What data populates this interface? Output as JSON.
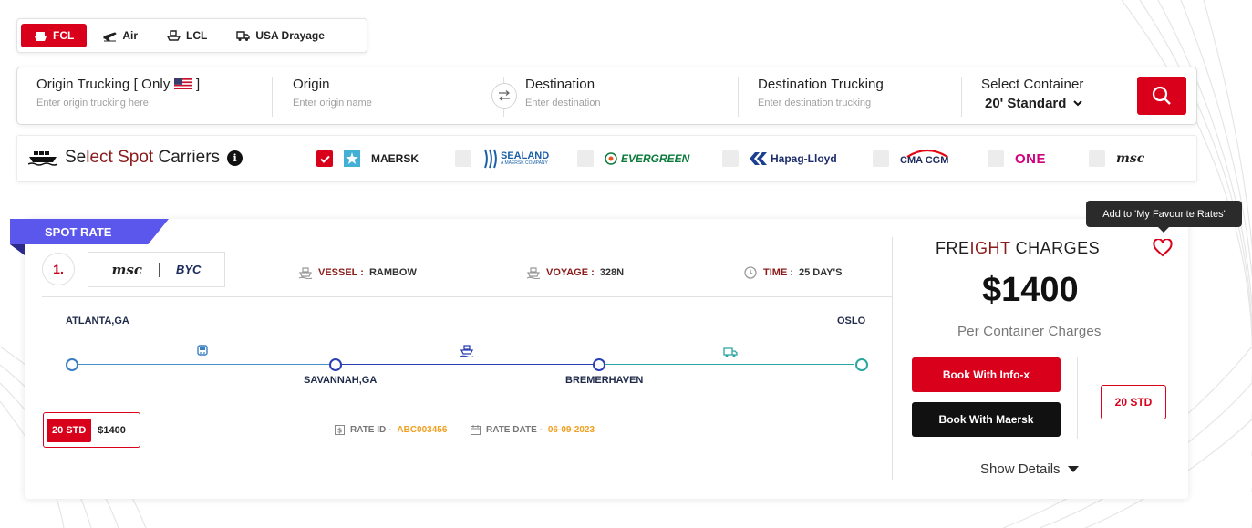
{
  "colors": {
    "accent": "#d9001b",
    "ribbon": "#5b57ec",
    "dark_accent": "#8b1a1a",
    "amber": "#f0a020"
  },
  "mode_tabs": [
    {
      "label": "FCL",
      "icon": "ship-icon",
      "active": true
    },
    {
      "label": "Air",
      "icon": "plane-icon"
    },
    {
      "label": "LCL",
      "icon": "boat-icon"
    },
    {
      "label": "USA Drayage",
      "icon": "truck-icon"
    }
  ],
  "search": {
    "origin_trucking": {
      "label_pre": "Origin Trucking [ Only",
      "label_post": "]",
      "placeholder": "Enter origin trucking here"
    },
    "origin": {
      "label": "Origin",
      "placeholder": "Enter origin name"
    },
    "destination": {
      "label": "Destination",
      "placeholder": "Enter destination"
    },
    "destination_trucking": {
      "label": "Destination Trucking",
      "placeholder": "Enter destination trucking"
    },
    "container": {
      "label": "Select Container",
      "value": "20' Standard"
    }
  },
  "carriers": {
    "title_pre": "Se",
    "title_acc": "lect Spot",
    "title_post": " Carriers",
    "items": [
      {
        "name": "MAERSK",
        "checked": true
      },
      {
        "name": "SEALAND",
        "sub": "A MAERSK COMPANY",
        "checked": false
      },
      {
        "name": "EVERGREEN",
        "checked": false
      },
      {
        "name": "Hapag-Lloyd",
        "checked": false
      },
      {
        "name": "CMA CGM",
        "checked": false
      },
      {
        "name": "ONE",
        "checked": false
      },
      {
        "name": "msc",
        "checked": false
      }
    ]
  },
  "rate": {
    "ribbon": "SPOT RATE",
    "rank": "1.",
    "carrier_logos": [
      "msc",
      "BYC"
    ],
    "vessel_label": "VESSEL :",
    "vessel_value": "RAMBOW",
    "voyage_label": "VOYAGE :",
    "voyage_value": "328N",
    "time_label": "TIME :",
    "time_value": "25 DAY'S",
    "origin": "ATLANTA,GA",
    "destination": "OSLO",
    "via1": "SAVANNAH,GA",
    "via2": "BREMERHAVEN",
    "chip_tag": "20 STD",
    "chip_price": "$1400",
    "rate_id_label": "RATE ID -",
    "rate_id_value": "ABC003456",
    "rate_date_label": "RATE DATE -",
    "rate_date_value": "06-09-2023",
    "freight_title_pre": "FRE",
    "freight_title_acc": "IGHT",
    "freight_title_post": " CHARGES",
    "price": "$1400",
    "price_sub": "Per Container Charges",
    "book_infox": "Book With Info-x",
    "book_maersk": "Book With Maersk",
    "std_button": "20 STD",
    "show_details": "Show Details",
    "tooltip": "Add to 'My Favourite Rates'"
  }
}
